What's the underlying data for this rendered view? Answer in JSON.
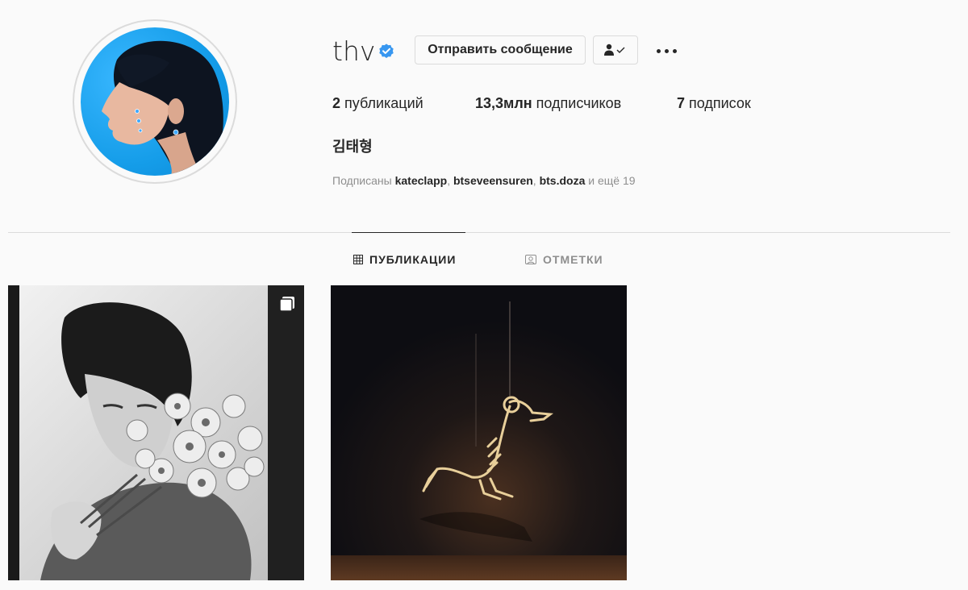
{
  "profile": {
    "username": "thv",
    "verified": true,
    "full_name": "김태형",
    "message_button": "Отправить сообщение",
    "follow_button_icon": "person-check-icon",
    "more_icon": "more-horizontal-icon"
  },
  "stats": {
    "posts_count": "2",
    "posts_label": " публикаций",
    "followers_count": "13,3млн",
    "followers_label": " подписчиков",
    "following_count": "7",
    "following_label": " подписок"
  },
  "followed_by": {
    "prefix": "Подписаны ",
    "users": [
      "kateclapp",
      "btseveensuren",
      "bts.doza"
    ],
    "sep": ", ",
    "suffix": " и ещё 19"
  },
  "tabs": [
    {
      "label": "ПУБЛИКАЦИИ",
      "icon": "grid-icon",
      "active": true
    },
    {
      "label": "ОТМЕТКИ",
      "icon": "tagged-icon",
      "active": false
    }
  ],
  "posts": [
    {
      "kind": "carousel",
      "icon": "multiple-photos-icon"
    },
    {
      "kind": "photo"
    }
  ],
  "colors": {
    "background": "#fafafa",
    "text": "#262626",
    "secondary": "#8e8e8e",
    "border": "#dbdbdb",
    "verified": "#3897f0"
  }
}
